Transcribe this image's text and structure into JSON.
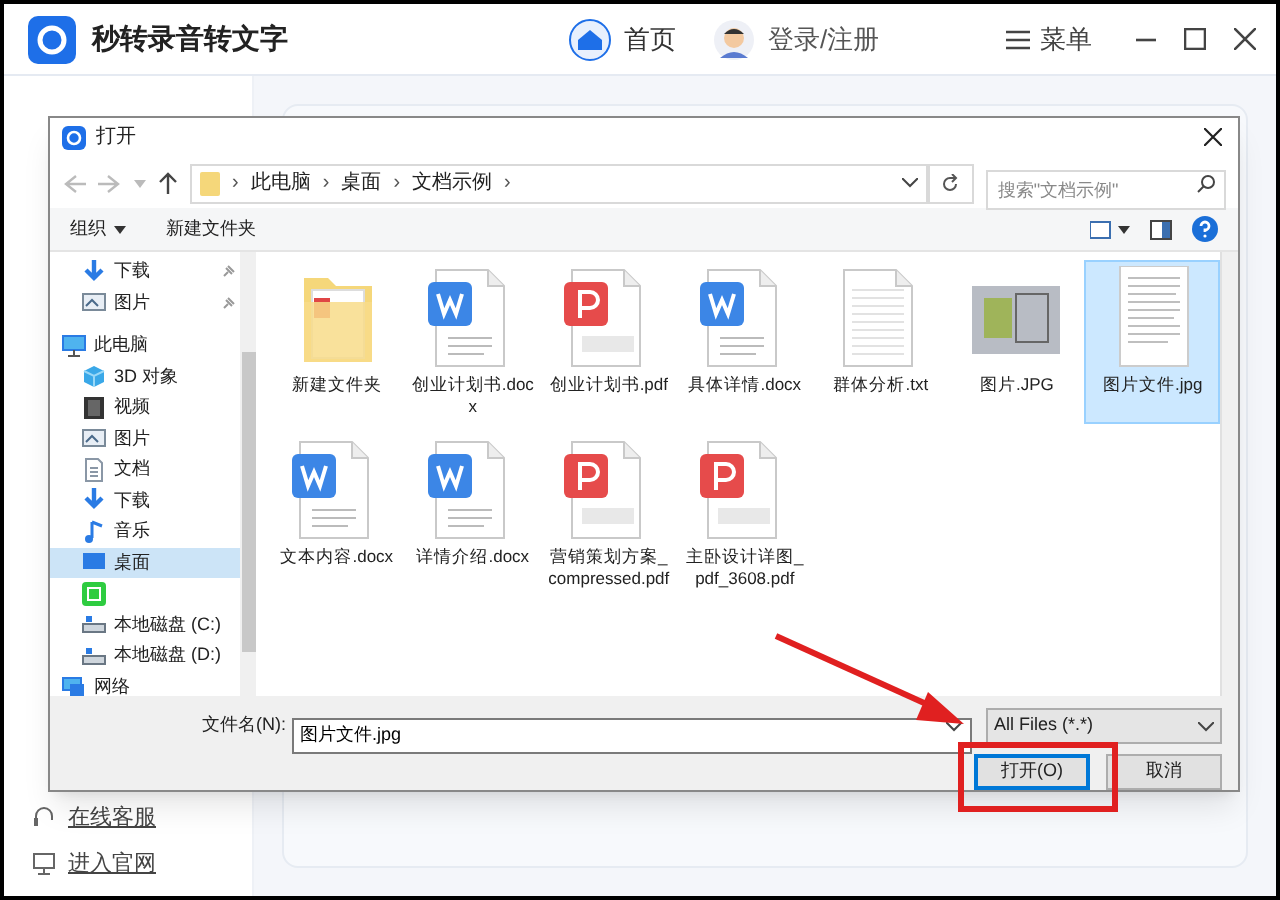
{
  "app": {
    "title": "秒转录音转文字",
    "nav": [
      {
        "label": "首页",
        "kind": "home",
        "selected": true
      },
      {
        "label": "登录/注册",
        "kind": "user",
        "selected": false
      }
    ],
    "menu": "菜单",
    "sidebar_links": [
      "在线客服",
      "进入官网"
    ]
  },
  "dialog": {
    "title": "打开",
    "path": [
      {
        "label": "›",
        "kind": "separator"
      },
      {
        "label": "此电脑",
        "kind": "crumb"
      },
      {
        "label": "›",
        "kind": "separator"
      },
      {
        "label": "桌面",
        "kind": "crumb"
      },
      {
        "label": "›",
        "kind": "separator"
      },
      {
        "label": "文档示例",
        "kind": "crumb"
      },
      {
        "label": "›",
        "kind": "separator"
      }
    ],
    "search": {
      "placeholder": "搜索\"文档示例\""
    },
    "toolbar": [
      "组织",
      "新建文件夹"
    ],
    "tree": [
      {
        "label": "下载",
        "kind": "download",
        "pinned": true,
        "selected": false
      },
      {
        "label": "图片",
        "kind": "picture",
        "pinned": true,
        "selected": false
      },
      {
        "label": "此电脑",
        "kind": "pc",
        "pinned": false,
        "selected": false,
        "children": [
          {
            "label": "3D 对象",
            "kind": "cube",
            "selected": false
          },
          {
            "label": "视频",
            "kind": "video",
            "selected": false
          },
          {
            "label": "图片",
            "kind": "picture",
            "selected": false
          },
          {
            "label": "文档",
            "kind": "document",
            "selected": false
          },
          {
            "label": "下载",
            "kind": "download",
            "selected": false
          },
          {
            "label": "音乐",
            "kind": "music",
            "selected": false
          },
          {
            "label": "桌面",
            "kind": "desktop",
            "selected": true
          },
          {
            "kind": "app",
            "selected": false
          },
          {
            "label": "本地磁盘 (C:)",
            "kind": "drive",
            "selected": false
          },
          {
            "label": "本地磁盘 (D:)",
            "kind": "drive",
            "selected": false
          }
        ]
      },
      {
        "label": "网络",
        "kind": "network",
        "pinned": false,
        "selected": false
      }
    ],
    "files": [
      {
        "name": "新建文件夹",
        "kind": "folder",
        "selected": false
      },
      {
        "name": "创业计划书.docx",
        "kind": "word",
        "selected": false
      },
      {
        "name": "创业计划书.pdf",
        "kind": "pdf",
        "selected": false
      },
      {
        "name": "具体详情.docx",
        "kind": "word",
        "selected": false
      },
      {
        "name": "群体分析.txt",
        "kind": "text",
        "selected": false
      },
      {
        "name": "图片.JPG",
        "kind": "image",
        "selected": false
      },
      {
        "name": "图片文件.jpg",
        "kind": "page",
        "selected": true
      },
      {
        "name": "文本内容.docx",
        "kind": "word",
        "selected": false
      },
      {
        "name": "详情介绍.docx",
        "kind": "word",
        "selected": false
      },
      {
        "name": "营销策划方案_compressed.pdf",
        "kind": "pdf",
        "selected": false
      },
      {
        "name": "主卧设计详图_pdf_3608.pdf",
        "kind": "pdf",
        "selected": false
      }
    ],
    "filename_label": "文件名(N):",
    "filename": "图片文件.jpg",
    "filter": "All Files (*.*)",
    "buttons": [
      {
        "label": "打开(O)",
        "kind": "primary"
      },
      {
        "label": "取消",
        "kind": "secondary"
      }
    ]
  }
}
